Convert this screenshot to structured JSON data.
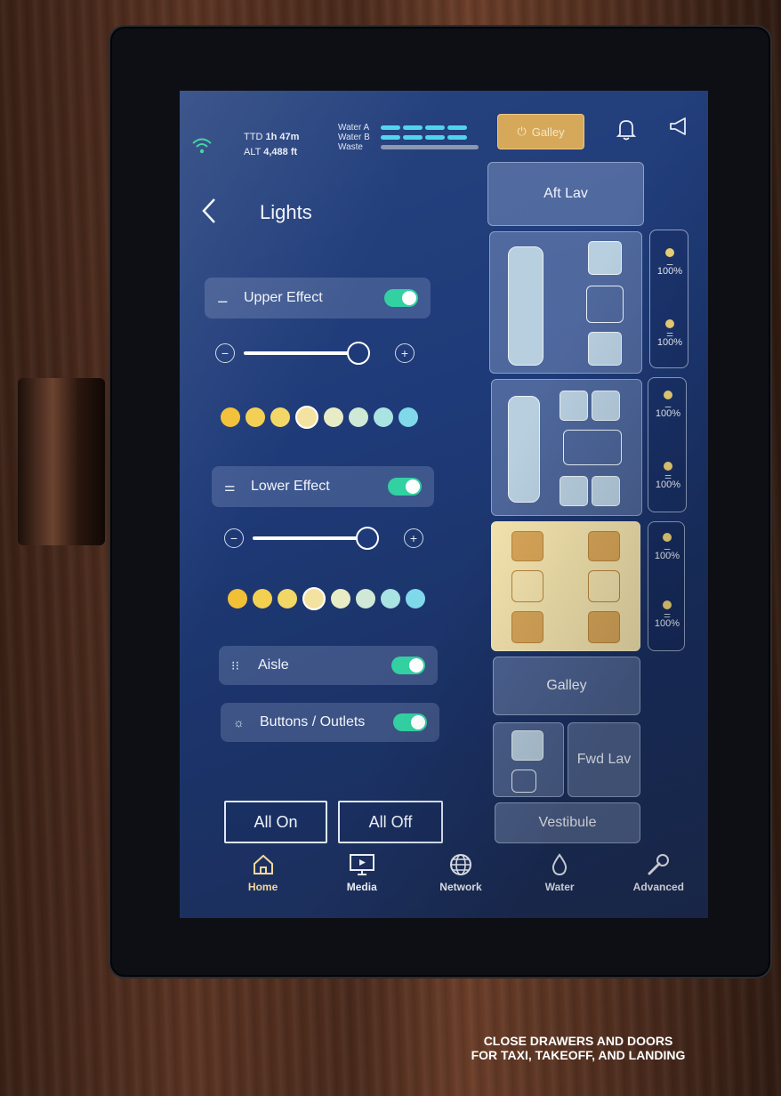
{
  "status_bar": {
    "wifi_icon": "wifi-icon",
    "ttd_label": "TTD",
    "ttd_value": "1h 47m",
    "alt_label": "ALT",
    "alt_value": "4,488 ft",
    "tanks": [
      {
        "label": "Water A",
        "level": 1.0,
        "color": "#4fd4f0"
      },
      {
        "label": "Water B",
        "level": 1.0,
        "color": "#4fd4f0"
      },
      {
        "label": "Waste",
        "level": 0.0,
        "color": "#8b98ad"
      }
    ],
    "galley_button_label": "Galley",
    "galley_button_color": "#d6a85a",
    "bell_icon": "bell-icon",
    "announce_icon": "megaphone-icon"
  },
  "page": {
    "title": "Lights",
    "back_icon": "chevron-left-icon"
  },
  "upper_effect": {
    "label": "Upper Effect",
    "enabled": true,
    "brightness": 1.0,
    "swatches": [
      "#f2c037",
      "#f3cf52",
      "#f2d767",
      "#f4e3a0",
      "#e8ecc4",
      "#cfe9d6",
      "#a9e3e2",
      "#7fd9ea"
    ],
    "selected_swatch": 3
  },
  "lower_effect": {
    "label": "Lower Effect",
    "enabled": true,
    "brightness": 1.0,
    "swatches": [
      "#f2c037",
      "#f3cf52",
      "#f2d767",
      "#f4e3a0",
      "#e8ecc4",
      "#cfe9d6",
      "#a9e3e2",
      "#7fd9ea"
    ],
    "selected_swatch": 3
  },
  "aisle": {
    "label": "Aisle",
    "enabled": true
  },
  "buttons_outlets": {
    "label": "Buttons / Outlets",
    "enabled": true
  },
  "all_on_label": "All On",
  "all_off_label": "All Off",
  "zones": {
    "aft_lav": "Aft Lav",
    "galley": "Galley",
    "fwd_lav": "Fwd Lav",
    "vestibule": "Vestibule"
  },
  "zone_levels": [
    {
      "upper": "100%",
      "lower": "100%"
    },
    {
      "upper": "100%",
      "lower": "100%"
    },
    {
      "upper": "100%",
      "lower": "100%"
    }
  ],
  "active_zone_color": "#f3e3ad",
  "nav": [
    {
      "label": "Home",
      "icon": "home-icon",
      "active": true
    },
    {
      "label": "Media",
      "icon": "monitor-icon",
      "active": false
    },
    {
      "label": "Network",
      "icon": "globe-icon",
      "active": false
    },
    {
      "label": "Water",
      "icon": "droplet-icon",
      "active": false
    },
    {
      "label": "Advanced",
      "icon": "wrench-icon",
      "active": false
    }
  ],
  "placard": {
    "line1": "CLOSE DRAWERS AND DOORS",
    "line2": "FOR TAXI, TAKEOFF, AND LANDING"
  }
}
